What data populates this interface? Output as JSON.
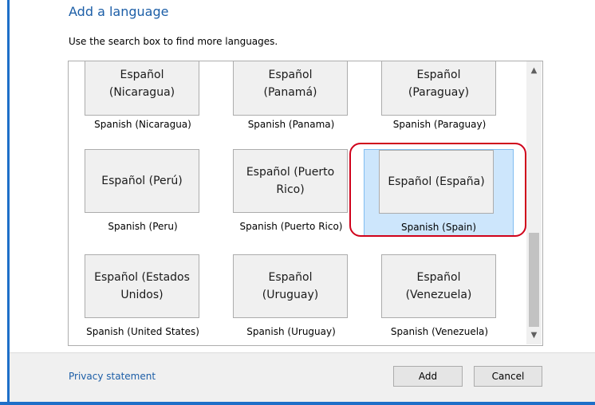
{
  "dialog": {
    "title": "Add a language",
    "subtitle": "Use the search box to find more languages."
  },
  "languages": [
    {
      "native": "Español (Nicaragua)",
      "english": "Spanish (Nicaragua)"
    },
    {
      "native": "Español (Panamá)",
      "english": "Spanish (Panama)"
    },
    {
      "native": "Español (Paraguay)",
      "english": "Spanish (Paraguay)"
    },
    {
      "native": "Español (Perú)",
      "english": "Spanish (Peru)"
    },
    {
      "native": "Español (Puerto Rico)",
      "english": "Spanish (Puerto Rico)"
    },
    {
      "native": "Español (España)",
      "english": "Spanish (Spain)",
      "selected": true
    },
    {
      "native": "Español (Estados Unidos)",
      "english": "Spanish (United States)"
    },
    {
      "native": "Español (Uruguay)",
      "english": "Spanish (Uruguay)"
    },
    {
      "native": "Español (Venezuela)",
      "english": "Spanish (Venezuela)"
    }
  ],
  "footer": {
    "privacy_label": "Privacy statement",
    "add_label": "Add",
    "cancel_label": "Cancel"
  },
  "scrollbar": {
    "up_icon": "chevron-up-icon",
    "down_icon": "chevron-down-icon"
  },
  "colors": {
    "accent": "#1e6fc8",
    "selected_bg": "#cde6fc",
    "highlight_ring": "#d0021b"
  }
}
